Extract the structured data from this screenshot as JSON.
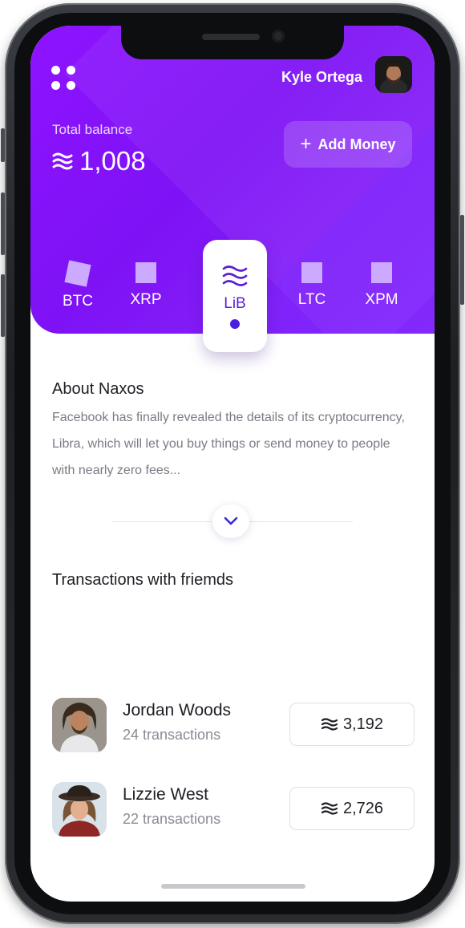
{
  "header": {
    "user_name": "Kyle Ortega",
    "total_label": "Total balance",
    "total_value": "1,008",
    "add_money_label": "Add Money"
  },
  "coins": [
    {
      "label": "BTC"
    },
    {
      "label": "XRP"
    },
    {
      "label": "LiB",
      "selected": true
    },
    {
      "label": "LTC"
    },
    {
      "label": "XPM"
    }
  ],
  "about": {
    "title": "About Naxos",
    "body": "Facebook has finally revealed the details of its cryptocurrency, Libra, which will let you buy things or send money to people with nearly zero fees..."
  },
  "transactions": {
    "title": "Transactions with friemds",
    "items": [
      {
        "name": "Jordan Woods",
        "count": "24 transactions",
        "amount": "3,192"
      },
      {
        "name": "Lizzie West",
        "count": "22 transactions",
        "amount": "2,726"
      }
    ]
  },
  "colors": {
    "brand": "#8e13ff",
    "coin_square": "#ccaaff",
    "selected_accent": "#4a1ee0"
  },
  "icons": {
    "menu": "grid-dots-icon",
    "currency": "libra-wave-icon",
    "expand": "chevron-down-icon",
    "add": "plus-icon"
  }
}
